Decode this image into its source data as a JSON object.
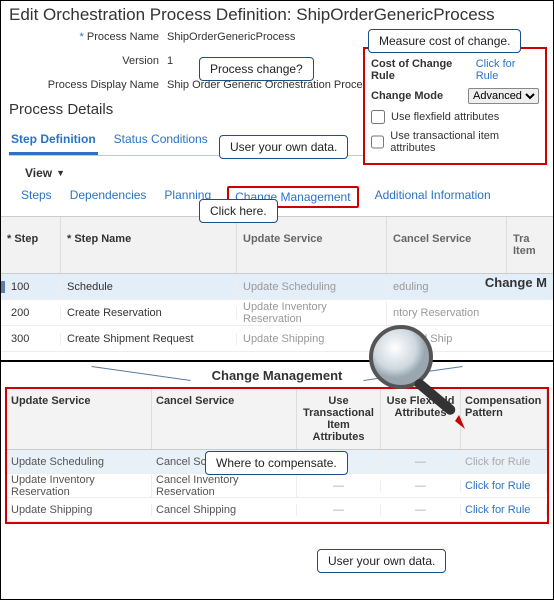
{
  "header": "Edit Orchestration Process Definition: ShipOrderGenericProcess",
  "form": {
    "processNameLabel": "Process Name",
    "processName": "ShipOrderGenericProcess",
    "versionLabel": "Version",
    "version": "1",
    "displayNameLabel": "Process Display Name",
    "displayName": "Ship Order Generic Orchestration Process"
  },
  "callouts": {
    "measure": "Measure cost of change.",
    "processChange": "Process change?",
    "ownData1": "User your own data.",
    "clickHere": "Click here.",
    "whereComp": "Where to compensate.",
    "ownData2": "User your own data."
  },
  "rightPanel": {
    "costRuleLabel": "Cost of Change Rule",
    "costRuleLink": "Click for Rule",
    "changeModeLabel": "Change Mode",
    "changeModeValue": "Advanced",
    "flexfield": "Use flexfield attributes",
    "transactional": "Use transactional item attributes"
  },
  "detailsTitle": "Process Details",
  "tabs1": {
    "step": "Step Definition",
    "status": "Status Conditions"
  },
  "viewLabel": "View",
  "tabs2": {
    "steps": "Steps",
    "deps": "Dependencies",
    "plan": "Planning",
    "chg": "Change Management",
    "addl": "Additional Information"
  },
  "gridSuper": "Change M",
  "gridHead": {
    "step": "* Step",
    "name": "* Step Name",
    "upd": "Update Service",
    "can": "Cancel Service",
    "tr": "Tra\nItem"
  },
  "trHead1": "Tra",
  "trHead2": "Item",
  "rows": [
    {
      "step": "100",
      "name": "Schedule",
      "upd": "Update Scheduling",
      "can": "eduling",
      "sel": true
    },
    {
      "step": "200",
      "name": "Create Reservation",
      "upd": "Update Inventory Reservation",
      "can": "ntory Reservation",
      "sel": false
    },
    {
      "step": "300",
      "name": "Create Shipment Request",
      "upd": "Update Shipping",
      "can": "Cancel Ship",
      "sel": false
    }
  ],
  "cmTitle": "Change Management",
  "botHead": {
    "upd": "Update Service",
    "can": "Cancel Service",
    "tia": "Use Transactional Item Attributes",
    "flex": "Use Flexfield Attributes",
    "comp": "Compensation Pattern"
  },
  "botRows": [
    {
      "upd": "Update Scheduling",
      "can": "Cancel Scheduling",
      "comp": "Click for Rule",
      "dis": true,
      "sel": true
    },
    {
      "upd": "Update Inventory Reservation",
      "can": "Cancel Inventory Reservation",
      "comp": "Click for Rule",
      "dis": false,
      "sel": false
    },
    {
      "upd": "Update Shipping",
      "can": "Cancel Shipping",
      "comp": "Click for Rule",
      "dis": false,
      "sel": false
    }
  ],
  "dash": "—"
}
